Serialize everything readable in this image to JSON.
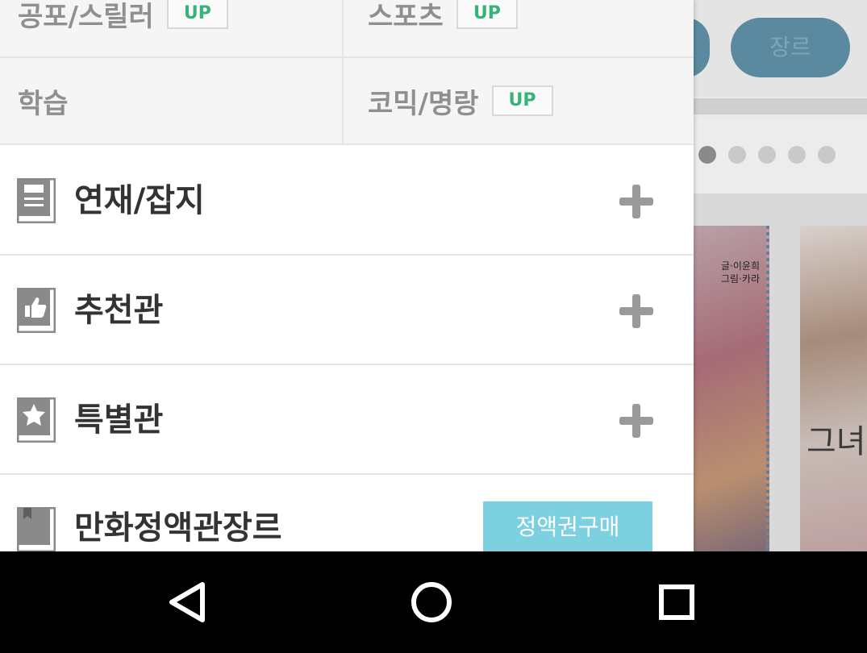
{
  "background_app": {
    "genre_button_label": "장르",
    "page_dots": 5,
    "card1_credit_line1": "글·이윤희",
    "card1_credit_line2": "그림·카라",
    "card2_cover_text": "그녀"
  },
  "genre_grid": {
    "rows": [
      [
        {
          "label": "공포/스릴러",
          "badge": "UP"
        },
        {
          "label": "스포츠",
          "badge": "UP"
        }
      ],
      [
        {
          "label": "학습",
          "badge": ""
        },
        {
          "label": "코믹/명랑",
          "badge": "UP"
        }
      ]
    ]
  },
  "menu": {
    "items": [
      {
        "label": "연재/잡지",
        "icon": "magazine-icon",
        "action": "plus-icon"
      },
      {
        "label": "추천관",
        "icon": "thumbs-up-icon",
        "action": "plus-icon"
      },
      {
        "label": "특별관",
        "icon": "star-icon",
        "action": "plus-icon"
      },
      {
        "label": "만화정액관장르",
        "icon": "bookmark-icon",
        "action_button": "정액권구매"
      }
    ]
  },
  "colors": {
    "up_badge_text": "#35b37a",
    "buy_button_bg": "#7dd0e0",
    "navbar_bg": "#000000",
    "genre_text": "#8f8f8f",
    "menu_text": "#333333"
  },
  "navbar": {
    "back": "back-triangle-icon",
    "home": "home-circle-icon",
    "recents": "recents-square-icon"
  }
}
